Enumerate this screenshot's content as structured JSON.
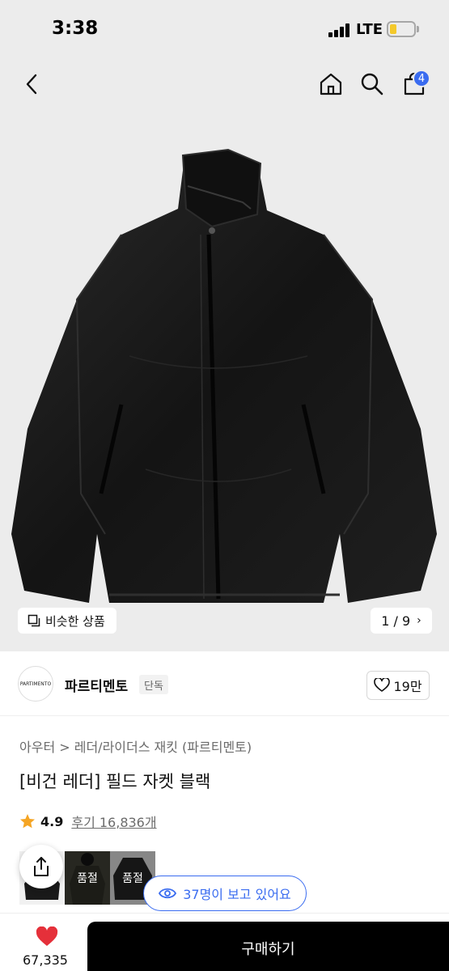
{
  "status_bar": {
    "time": "3:38",
    "network": "LTE"
  },
  "header": {
    "cart_count": "4",
    "icons": [
      "back-icon",
      "home-icon",
      "search-icon",
      "bag-icon"
    ]
  },
  "gallery": {
    "similar_label": "비슷한 상품",
    "pager": "1 / 9"
  },
  "brand": {
    "logo_text": "PARTIMENTO",
    "name": "파르티멘토",
    "tag": "단독",
    "likes": "19만"
  },
  "product": {
    "category": "아우터 > 레더/라이더스 재킷 (파르티멘토)",
    "title": "[비건 레더] 필드 자켓 블랙",
    "rating": "4.9",
    "reviews": "후기 16,836개"
  },
  "color_options": [
    {
      "label": ""
    },
    {
      "label": "품절"
    },
    {
      "label": "품절"
    }
  ],
  "viewers": "37명이 보고 있어요",
  "bottom_bar": {
    "wish_count": "67,335",
    "buy_label": "구매하기"
  },
  "colors": {
    "accent": "#3a6cf0",
    "heart": "#e5303a",
    "star": "#f5a524",
    "buy_button": "#000000",
    "hero_background": "#ececec"
  }
}
